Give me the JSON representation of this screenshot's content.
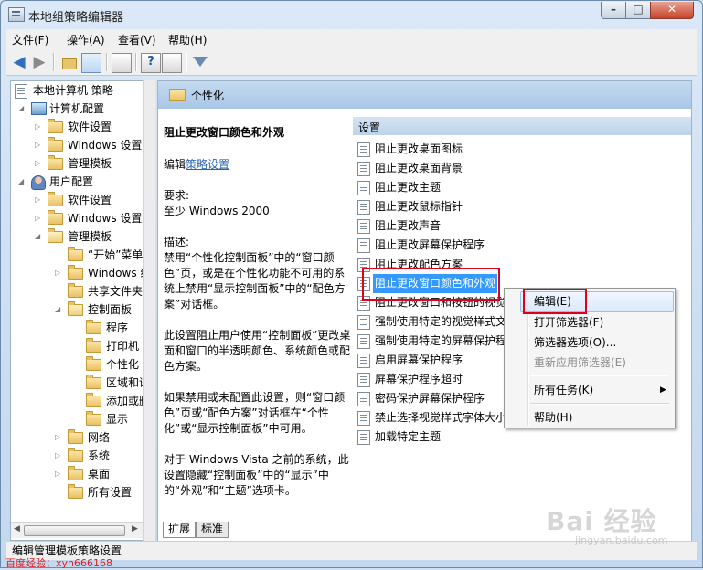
{
  "window": {
    "title": "本地组策略编辑器",
    "min_glyph": "–",
    "max_glyph": "□",
    "close_glyph": "✕"
  },
  "menu": [
    "文件(F)",
    "操作(A)",
    "查看(V)",
    "帮助(H)"
  ],
  "toolbar": {
    "back": "◀",
    "forward": "▶",
    "help": "?"
  },
  "tree": [
    {
      "label": "本地计算机 策略",
      "icon": "policy-icon"
    },
    {
      "label": "计算机配置",
      "icon": "computer-icon"
    },
    {
      "label": "软件设置",
      "icon": "folder-icon"
    },
    {
      "label": "Windows 设置",
      "icon": "folder-icon"
    },
    {
      "label": "管理模板",
      "icon": "folder-icon"
    },
    {
      "label": "用户配置",
      "icon": "user-icon"
    },
    {
      "label": "软件设置",
      "icon": "folder-icon"
    },
    {
      "label": "Windows 设置",
      "icon": "folder-icon"
    },
    {
      "label": "管理模板",
      "icon": "folder-icon"
    },
    {
      "label": "“开始”菜单",
      "icon": "folder-icon"
    },
    {
      "label": "Windows 组件",
      "icon": "folder-icon"
    },
    {
      "label": "共享文件夹",
      "icon": "folder-icon"
    },
    {
      "label": "控制面板",
      "icon": "folder-icon"
    },
    {
      "label": "程序",
      "icon": "folder-icon"
    },
    {
      "label": "打印机",
      "icon": "folder-icon"
    },
    {
      "label": "个性化",
      "icon": "folder-icon"
    },
    {
      "label": "区域和语言",
      "icon": "folder-icon"
    },
    {
      "label": "添加或删除",
      "icon": "folder-icon"
    },
    {
      "label": "显示",
      "icon": "folder-icon"
    },
    {
      "label": "网络",
      "icon": "folder-icon"
    },
    {
      "label": "系统",
      "icon": "folder-icon"
    },
    {
      "label": "桌面",
      "icon": "folder-icon"
    },
    {
      "label": "所有设置",
      "icon": "all-settings-icon"
    }
  ],
  "right": {
    "header_title": "个性化",
    "description": {
      "title": "阻止更改窗口颜色和外观",
      "edit_prefix": "编辑",
      "edit_link": "策略设置",
      "req_label": "要求:",
      "req_value": "至少 Windows 2000",
      "desc_label": "描述:",
      "p1": "禁用“个性化控制面板”中的“窗口颜色”页，或是在个性化功能不可用的系统上禁用“显示控制面板”中的“配色方案”对话框。",
      "p2": "此设置阻止用户使用“控制面板”更改桌面和窗口的半透明颜色、系统颜色或配色方案。",
      "p3": "如果禁用或未配置此设置，则“窗口颜色”页或“配色方案”对话框在“个性化”或“显示控制面板”中可用。",
      "p4": "对于 Windows Vista 之前的系统，此设置隐藏“控制面板”中的“显示”中的“外观”和“主题”选项卡。"
    },
    "settings_header": "设置",
    "settings": [
      "阻止更改桌面图标",
      "阻止更改桌面背景",
      "阻止更改主题",
      "阻止更改鼠标指针",
      "阻止更改声音",
      "阻止更改屏幕保护程序",
      "阻止更改配色方案",
      "阻止更改窗口颜色和外观",
      "阻止更改窗口和按钮的视觉样式",
      "强制使用特定的视觉样式文件",
      "强制使用特定的屏幕保护程序",
      "启用屏幕保护程序",
      "屏幕保护程序超时",
      "密码保护屏幕保护程序",
      "禁止选择视觉样式字体大小",
      "加载特定主题"
    ]
  },
  "context_menu": {
    "items": [
      "编辑(E)",
      "打开筛选器(F)",
      "筛选器选项(O)...",
      "重新应用筛选器(E)",
      "所有任务(K)",
      "帮助(H)"
    ],
    "submenu_arrow": "▶"
  },
  "tabs": [
    "扩展",
    "标准"
  ],
  "status": "编辑管理模板策略设置",
  "watermark": "百度经验：xyh666168",
  "baidu_logo": "Bai 经验",
  "baidu_url": "jingyan.baidu.com",
  "colors": {
    "accent": "#3399ff",
    "highlight_box": "#e0001b",
    "link": "#2463b5"
  }
}
